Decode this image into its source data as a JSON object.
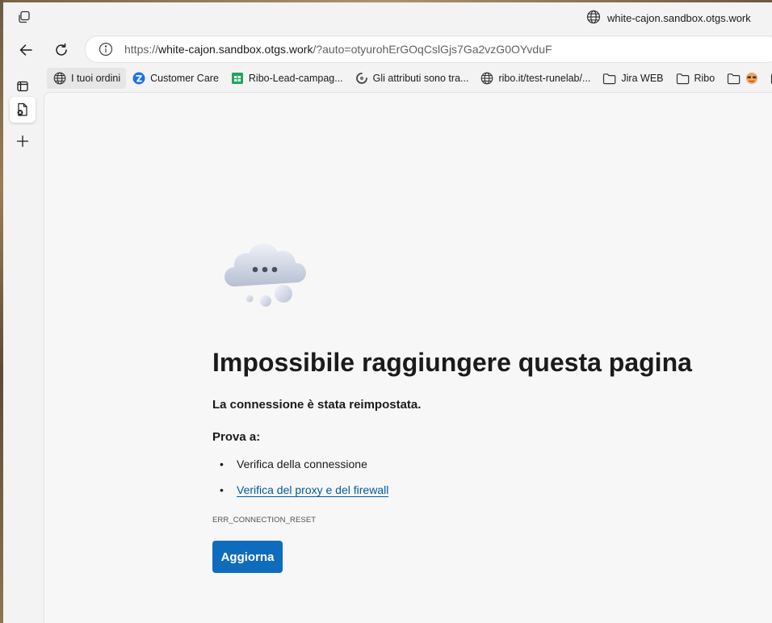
{
  "window": {
    "site_title": "white-cajon.sandbox.otgs.work"
  },
  "navbar": {
    "url_scheme": "https://",
    "url_host": "white-cajon.sandbox.otgs.work",
    "url_path": "/?auto=otyurohErGOqCslGjs7Ga2vzG0OYvduF"
  },
  "bookmarks": [
    {
      "label": "I tuoi ordini",
      "icon": "globe-icon"
    },
    {
      "label": "Customer Care",
      "icon": "customer-care-icon"
    },
    {
      "label": "Ribo-Lead-campag...",
      "icon": "sheets-icon"
    },
    {
      "label": "Gli attributi sono tra...",
      "icon": "loading-icon"
    },
    {
      "label": "ribo.it/test-runelab/...",
      "icon": "globe-icon"
    },
    {
      "label": "Jira WEB",
      "icon": "folder-icon"
    },
    {
      "label": "Ribo",
      "icon": "folder-icon"
    }
  ],
  "error": {
    "title": "Impossibile raggiungere questa pagina",
    "subtitle": "La connessione è stata reimpostata.",
    "try_label": "Prova a:",
    "suggestions": [
      "Verifica della connessione",
      "Verifica del proxy e del firewall"
    ],
    "code": "ERR_CONNECTION_RESET",
    "button": "Aggiorna"
  },
  "colors": {
    "accent": "#0f6cbd",
    "link": "#005a9e",
    "sheets_green": "#1fa463",
    "customer_care_blue": "#1a73e8"
  }
}
